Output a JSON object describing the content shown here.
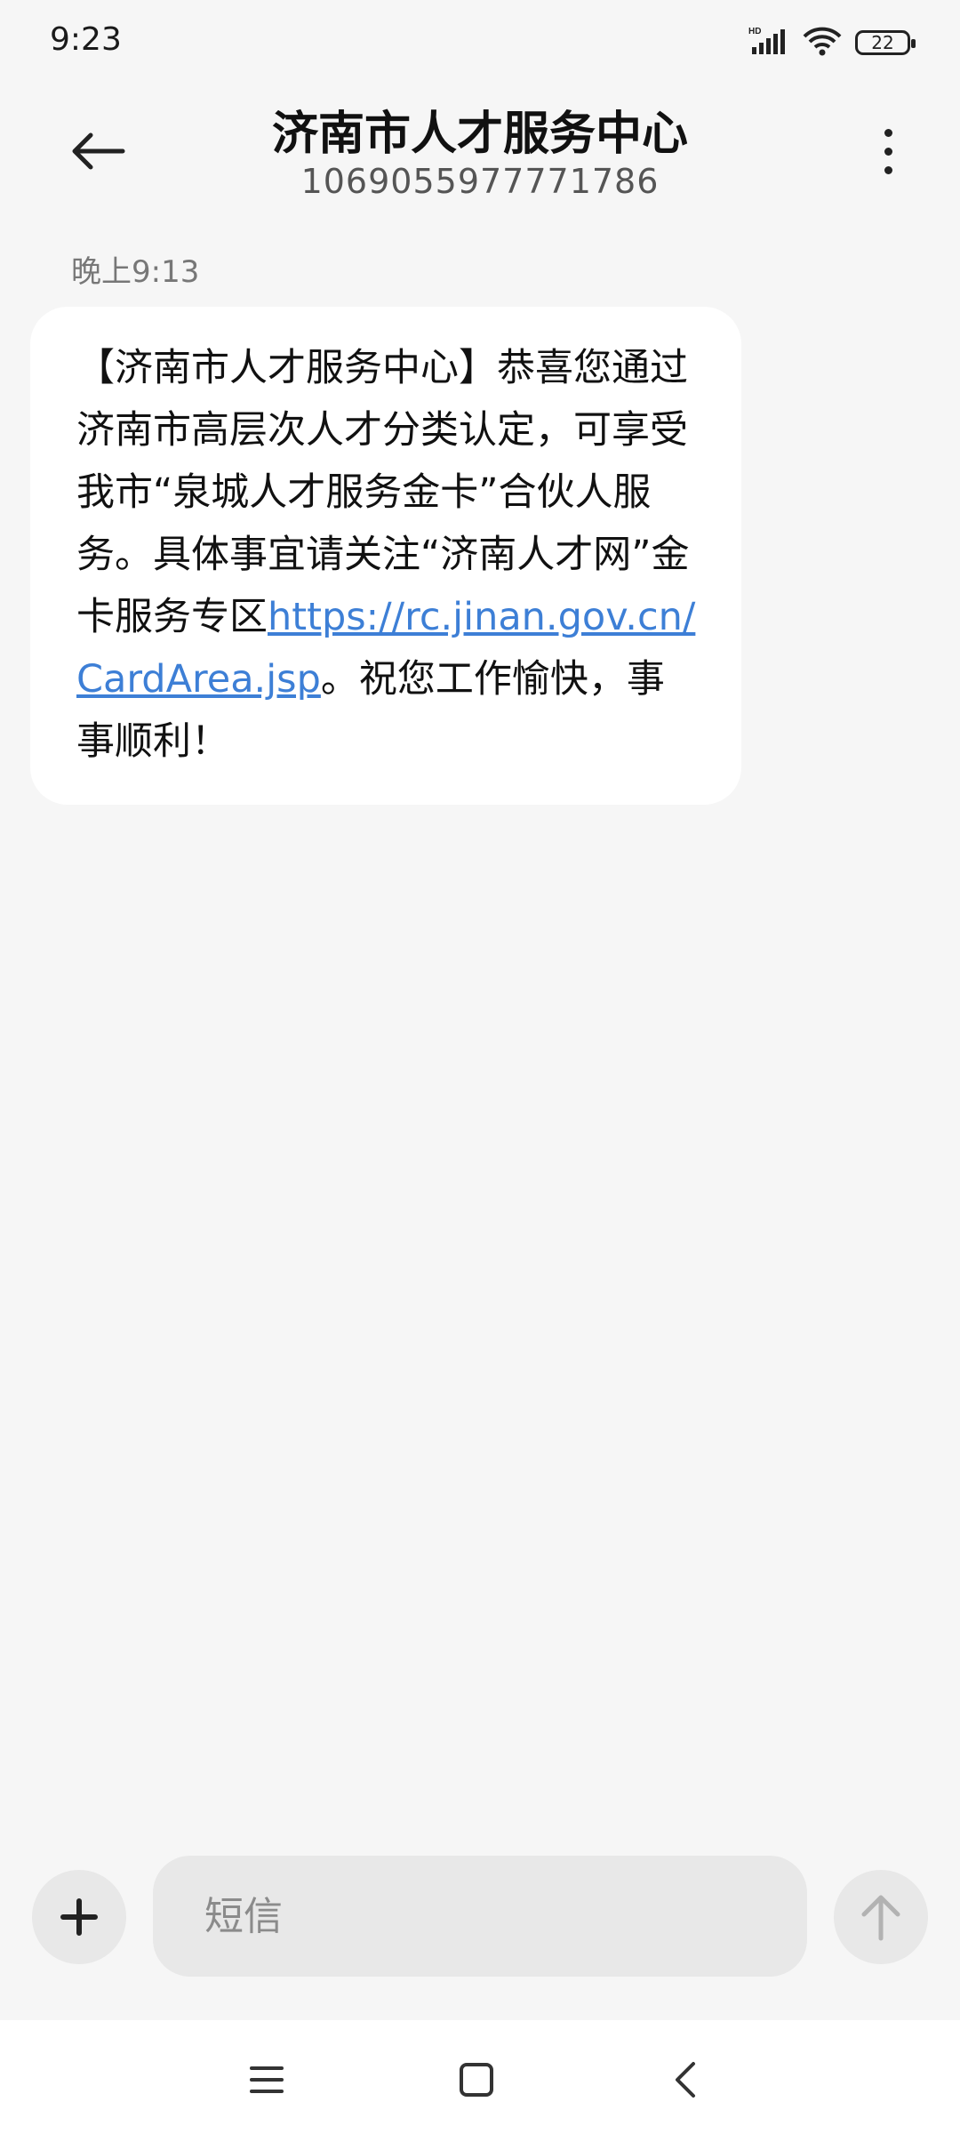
{
  "status_bar": {
    "time": "9:23",
    "battery": "22",
    "network_label": "HD"
  },
  "header": {
    "title": "济南市人才服务中心",
    "subtitle": "1069055977771786"
  },
  "conversation": {
    "timestamp": "晚上9:13",
    "message": {
      "text_before_link": "【济南市人才服务中心】恭喜您通过济南市高层次人才分类认定，可享受我市“泉城人才服务金卡”合伙人服务。具体事宜请关注“济南人才网”金卡服务专区",
      "link": "https://rc.jinan.gov.cn/CardArea.jsp",
      "text_after_link": "。祝您工作愉快，事事顺利！"
    }
  },
  "composer": {
    "placeholder": "短信"
  },
  "icons": {
    "back": "arrow-left-icon",
    "more": "more-vertical-icon",
    "attach": "plus-icon",
    "send": "arrow-up-icon",
    "nav_menu": "menu-icon",
    "nav_home": "square-icon",
    "nav_back": "chevron-left-icon"
  },
  "colors": {
    "link": "#3d7fd6",
    "background": "#f6f6f6",
    "bubble": "#ffffff",
    "control": "#e8e8e8"
  }
}
